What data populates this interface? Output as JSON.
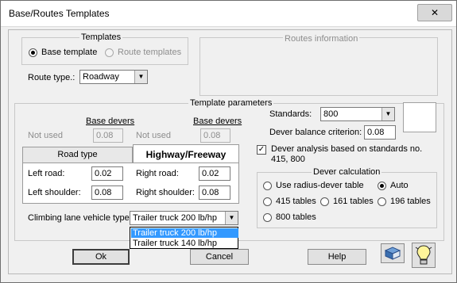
{
  "window": {
    "title": "Base/Routes Templates",
    "close_label": "✕"
  },
  "templates": {
    "group_label": "Templates",
    "base_label": "Base template",
    "route_label": "Route templates",
    "route_type_label": "Route type.:",
    "route_type_value": "Roadway"
  },
  "routes_info": {
    "group_label": "Routes information"
  },
  "params": {
    "group_label": "Template parameters",
    "base_devers_label": "Base devers",
    "not_used_label": "Not used",
    "left_value": "0.08",
    "right_value": "0.08",
    "tabs": [
      "Road type",
      "Highway/Freeway"
    ],
    "left_road_label": "Left road:",
    "left_road_value": "0.02",
    "right_road_label": "Right road:",
    "right_road_value": "0.02",
    "left_shoulder_label": "Left shoulder:",
    "left_shoulder_value": "0.08",
    "right_shoulder_label": "Right shoulder:",
    "right_shoulder_value": "0.08",
    "climbing_label": "Climbing lane vehicle type:",
    "climbing_value": "Trailer truck 200 lb/hp",
    "climbing_options": [
      "Trailer truck 200 lb/hp",
      "Trailer truck 140 lb/hp"
    ],
    "standards_label": "Standards:",
    "standards_value": "800",
    "balance_label": "Dever balance criterion:",
    "balance_value": "0.08",
    "analysis_line1": "Dever analysis based on standards no.",
    "analysis_line2": "415, 800"
  },
  "dever_calc": {
    "group_label": "Dever calculation",
    "options": [
      "Use radius-dever table",
      "Auto",
      "415 tables",
      "161 tables",
      "196 tables",
      "800 tables"
    ]
  },
  "buttons": {
    "ok": "Ok",
    "cancel": "Cancel",
    "help": "Help"
  }
}
